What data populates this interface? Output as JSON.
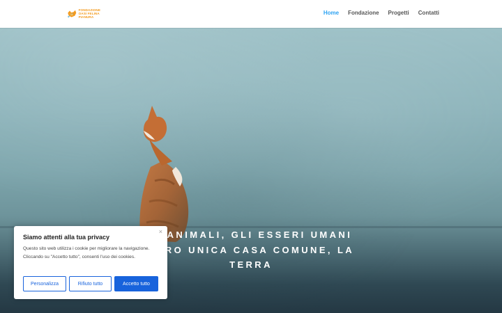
{
  "header": {
    "logo_lines": [
      "FONDAZIONE",
      "OASI FELINA",
      "PIANURA"
    ],
    "nav": [
      {
        "label": "Home",
        "active": true
      },
      {
        "label": "Fondazione",
        "active": false
      },
      {
        "label": "Progetti",
        "active": false
      },
      {
        "label": "Contatti",
        "active": false
      }
    ]
  },
  "hero": {
    "line1": "LI ANIMALI, GLI ESSERI UMANI",
    "line2": "LORO UNICA CASA COMUNE, LA",
    "line3": "TERRA"
  },
  "cookie": {
    "title": "Siamo attenti alla tua privacy",
    "body": "Questo sito web utilizza i cookie per migliorare la navigazione. Cliccando su \"Accetto tutto\",  consenti l'uso dei cookies.",
    "close": "×",
    "btn_customize": "Personalizza",
    "btn_reject": "Rifiuto tutto",
    "btn_accept": "Accetto tutto"
  },
  "colors": {
    "accent": "#2ea3f2",
    "cookie_button": "#1863dc",
    "logo": "#f39a1e"
  }
}
